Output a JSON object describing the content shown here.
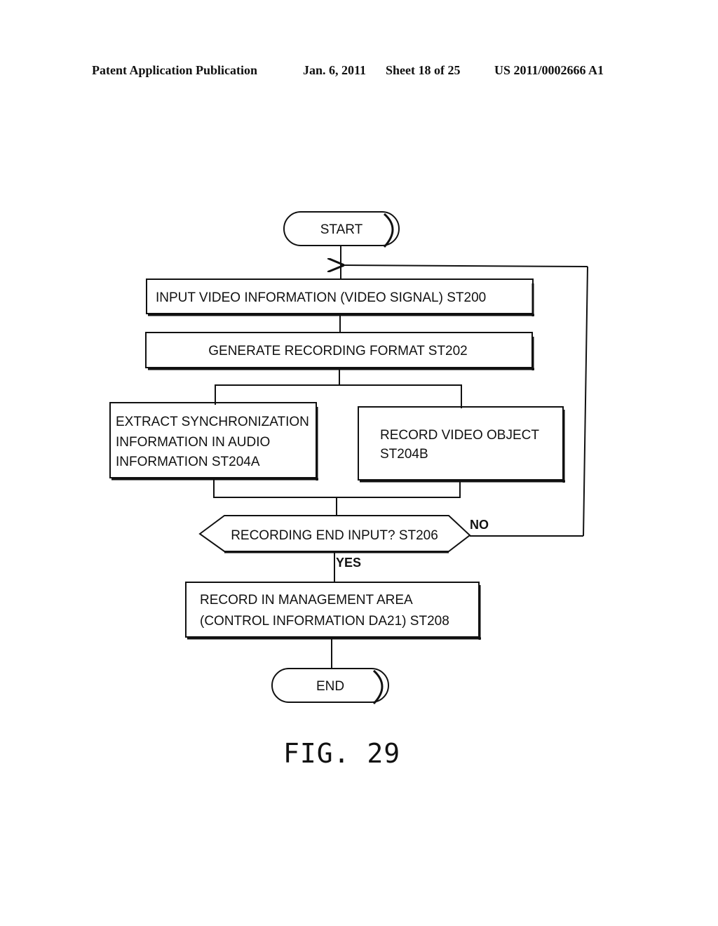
{
  "header": {
    "publication": "Patent Application Publication",
    "date": "Jan. 6, 2011",
    "sheet": "Sheet 18 of 25",
    "number": "US 2011/0002666 A1"
  },
  "flowchart": {
    "start": "START",
    "st200": "INPUT VIDEO INFORMATION (VIDEO SIGNAL) ST200",
    "st202": "GENERATE RECORDING FORMAT ST202",
    "st204a": [
      "EXTRACT SYNCHRONIZATION",
      "INFORMATION IN AUDIO",
      "INFORMATION ST204A"
    ],
    "st204b": [
      "RECORD VIDEO OBJECT",
      "ST204B"
    ],
    "st206": "RECORDING END INPUT? ST206",
    "no_label": "NO",
    "yes_label": "YES",
    "st208": [
      "RECORD IN MANAGEMENT AREA",
      "(CONTROL INFORMATION DA21) ST208"
    ],
    "end": "END"
  },
  "figure_label": "FIG. 29"
}
